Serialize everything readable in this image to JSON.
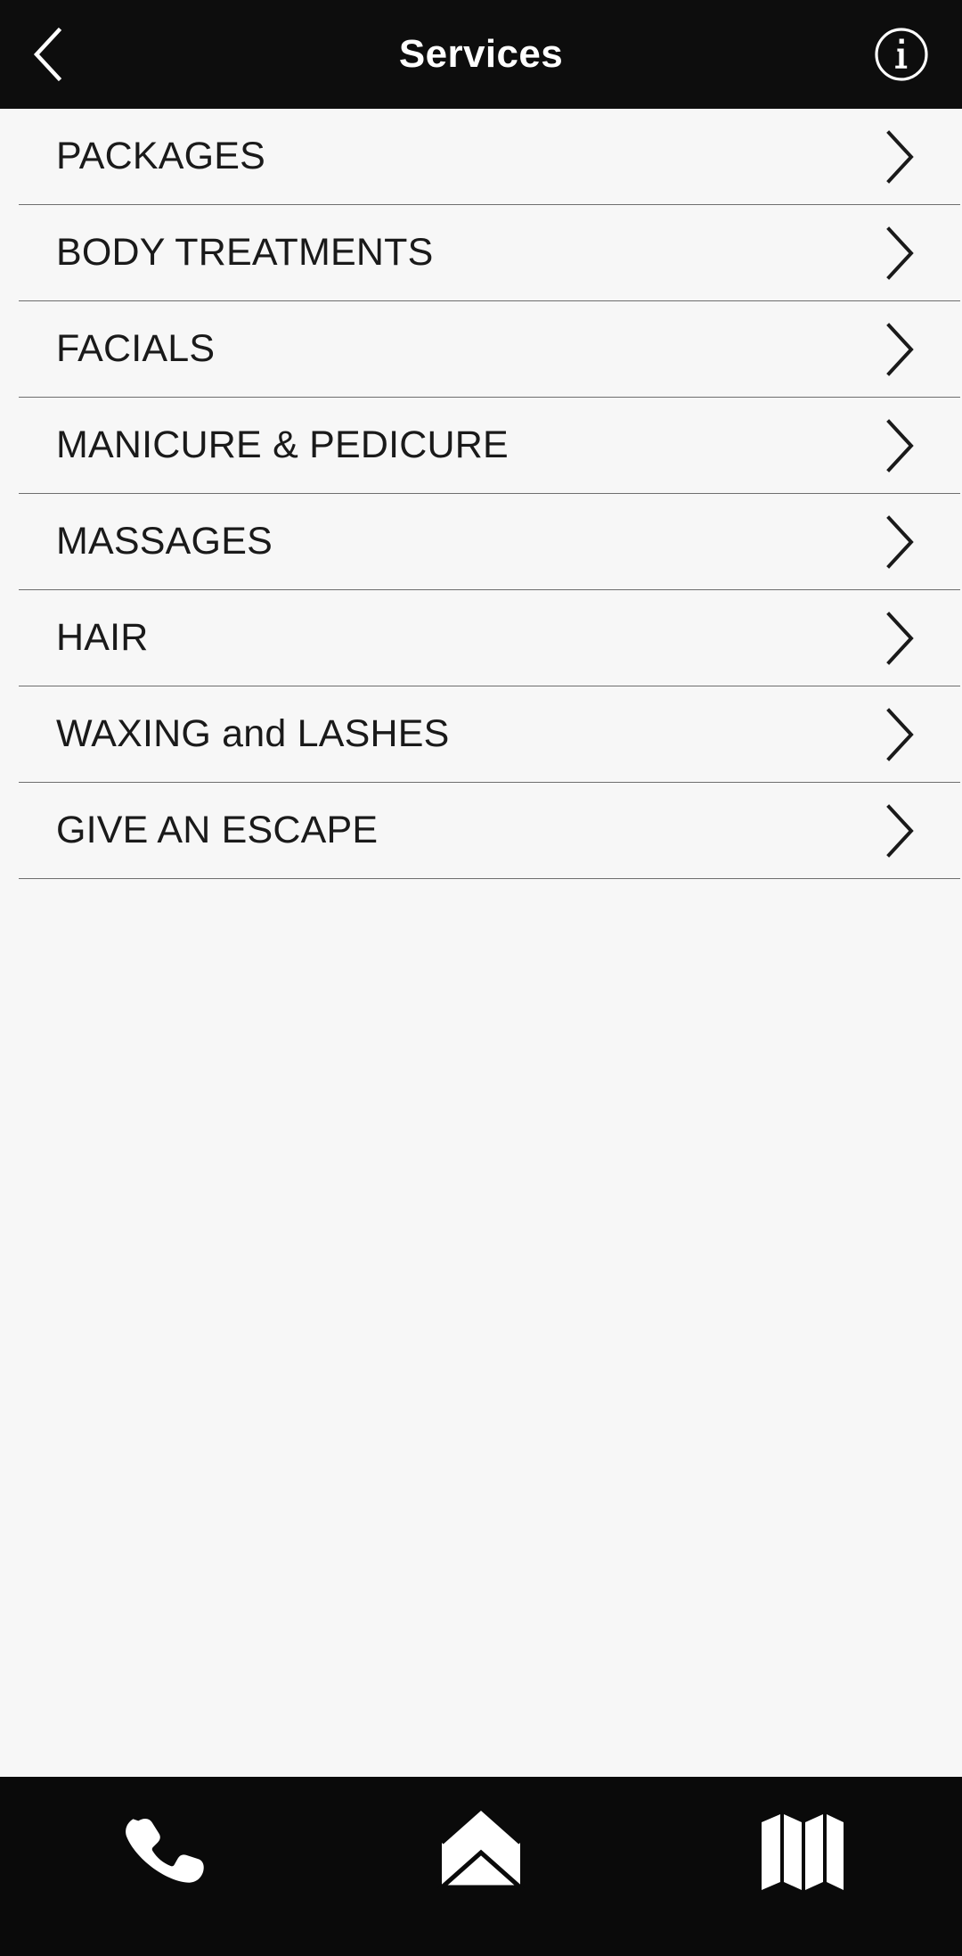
{
  "header": {
    "title": "Services",
    "back_icon": "chevron-left-icon",
    "info_icon": "info-circle-icon",
    "background_color": "#0d0d0d",
    "text_color": "#ffffff"
  },
  "list": {
    "background_color": "#f7f7f7",
    "divider_color": "#6e6e6e",
    "text_color": "#1a1a1a",
    "chevron_icon": "chevron-right-icon",
    "items": [
      {
        "label": "PACKAGES"
      },
      {
        "label": "BODY TREATMENTS"
      },
      {
        "label": "FACIALS"
      },
      {
        "label": "MANICURE & PEDICURE"
      },
      {
        "label": "MASSAGES"
      },
      {
        "label": "HAIR"
      },
      {
        "label": "WAXING and LASHES"
      },
      {
        "label": "GIVE AN ESCAPE"
      }
    ]
  },
  "bottom_bar": {
    "background_color": "#0a0a0a",
    "icon_color": "#ffffff",
    "buttons": [
      {
        "icon": "phone-icon",
        "name": "call-button"
      },
      {
        "icon": "envelope-icon",
        "name": "email-button"
      },
      {
        "icon": "map-icon",
        "name": "map-button"
      }
    ]
  }
}
